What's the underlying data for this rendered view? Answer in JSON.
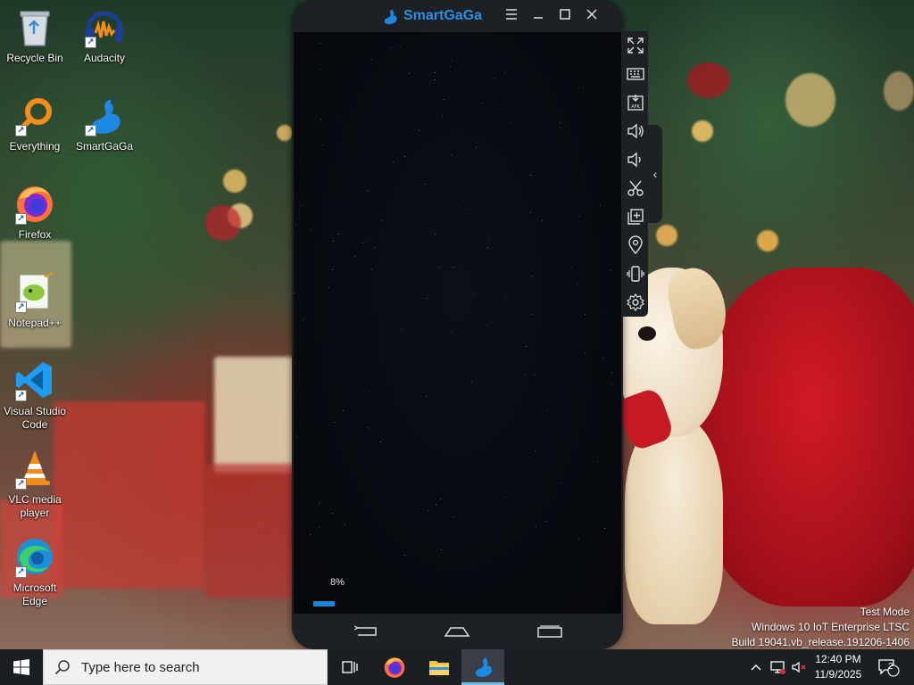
{
  "desktop": {
    "icons": [
      {
        "label": "Recycle Bin"
      },
      {
        "label": "Audacity"
      },
      {
        "label": "Everything"
      },
      {
        "label": "SmartGaGa"
      },
      {
        "label": "Firefox"
      },
      {
        "label": "Notepad++"
      },
      {
        "label": "Visual Studio Code"
      },
      {
        "label": "VLC media player"
      },
      {
        "label": "Microsoft Edge"
      }
    ]
  },
  "emulator": {
    "brand": "SmartGaGa",
    "title_controls": [
      "menu-icon",
      "minimize-icon",
      "maximize-icon",
      "close-icon"
    ],
    "loading": {
      "progress_label": "8%",
      "progress": 0.08
    },
    "nav_buttons": [
      "back-icon",
      "home-icon",
      "recents-icon"
    ],
    "side_toolbar": [
      "fullscreen-icon",
      "keyboard-icon",
      "apk-install-icon",
      "volume-up-icon",
      "volume-down-icon",
      "screenshot-scissors-icon",
      "multi-instance-icon",
      "location-icon",
      "shake-icon",
      "settings-icon"
    ]
  },
  "watermark": {
    "line1": "Test Mode",
    "line2": "Windows 10 IoT Enterprise LTSC",
    "line3": "Build 19041.vb_release.191206-1406"
  },
  "taskbar": {
    "search_placeholder": "Type here to search",
    "apps": [
      "task-view-icon",
      "firefox-icon",
      "file-explorer-icon",
      "smartgaga-icon"
    ],
    "active_app": "SmartGaGa",
    "clock_time": "12:40 PM",
    "clock_date": "11/9/2025",
    "notification_count": "2"
  },
  "colors": {
    "accent": "#1f86d6",
    "emulator_frame": "#1d2025",
    "taskbar_bg": "#1b1e22",
    "brand_blue": "#2c8fe0"
  }
}
